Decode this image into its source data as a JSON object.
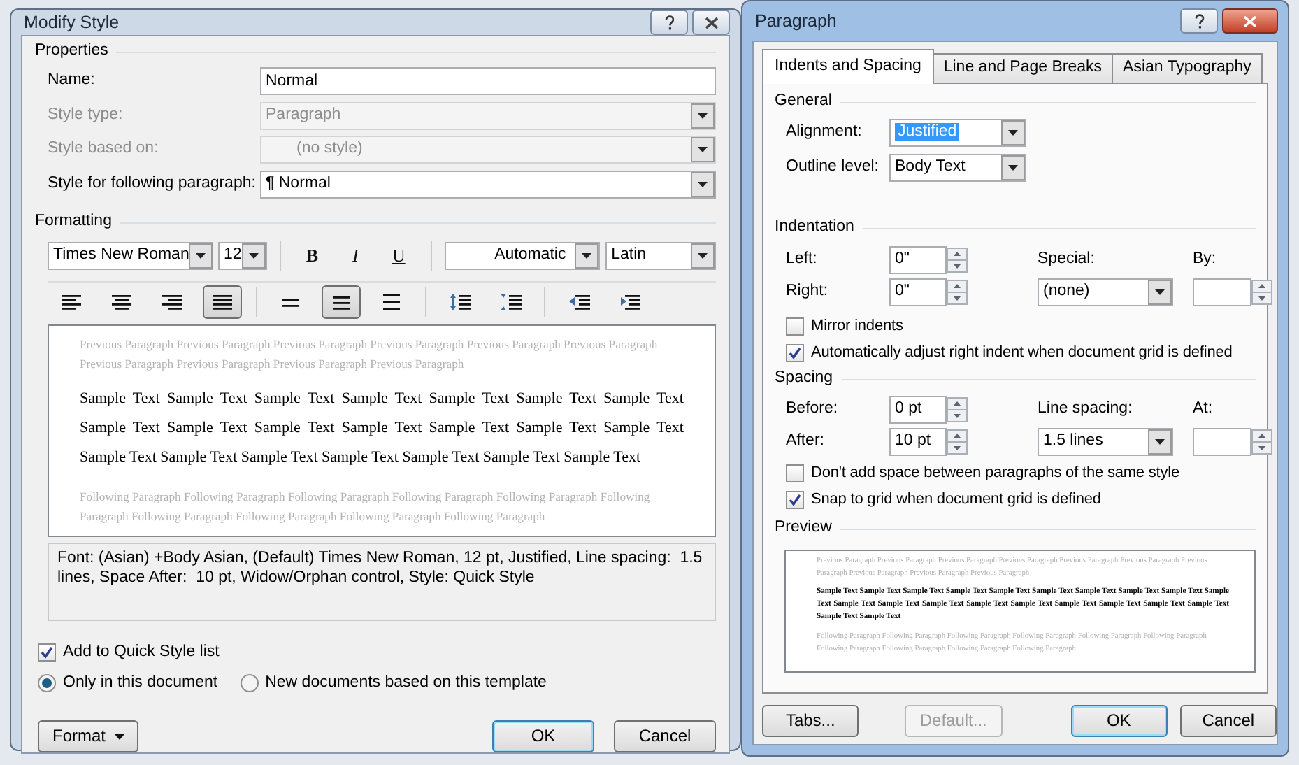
{
  "modify_style": {
    "title": "Modify Style",
    "properties": {
      "heading": "Properties",
      "fields": [
        {
          "kind": "text",
          "label": "Name:",
          "value": "Normal",
          "disabled": false
        },
        {
          "kind": "combo",
          "label": "Style type:",
          "value": "Paragraph",
          "disabled": true
        },
        {
          "kind": "combo",
          "label": "Style based on:",
          "value": "(no style)",
          "disabled": true
        },
        {
          "kind": "combo",
          "label": "Style for following paragraph:",
          "value": "¶ Normal",
          "disabled": false
        }
      ]
    },
    "formatting": {
      "heading": "Formatting",
      "font": "Times New Roman",
      "size": "12",
      "styles": [
        {
          "kind": "bold",
          "label": "B",
          "selected": false
        },
        {
          "kind": "italic",
          "label": "I",
          "selected": false
        },
        {
          "kind": "underline",
          "label": "U",
          "selected": false
        }
      ],
      "font_color": "Automatic",
      "script": "Latin",
      "paragraph_tools": [
        [
          {
            "kind": "align-left",
            "selected": false
          },
          {
            "kind": "align-center",
            "selected": false
          },
          {
            "kind": "align-right",
            "selected": false
          },
          {
            "kind": "justify",
            "selected": true
          }
        ],
        [
          {
            "kind": "single-spacing",
            "selected": false
          },
          {
            "kind": "one-half-spacing",
            "selected": true
          },
          {
            "kind": "double-spacing",
            "selected": false
          }
        ],
        [
          {
            "kind": "increase-paragraph-spacing",
            "selected": false
          },
          {
            "kind": "decrease-paragraph-spacing",
            "selected": false
          }
        ],
        [
          {
            "kind": "decrease-indent",
            "selected": false
          },
          {
            "kind": "increase-indent",
            "selected": false
          }
        ]
      ]
    },
    "preview": {
      "previous": "Previous Paragraph Previous Paragraph Previous Paragraph Previous Paragraph Previous Paragraph Previous Paragraph Previous Paragraph Previous Paragraph Previous Paragraph Previous Paragraph",
      "sample": "Sample Text Sample Text Sample Text Sample Text Sample Text Sample Text Sample Text Sample Text Sample Text Sample Text Sample Text Sample Text Sample Text Sample Text Sample Text Sample Text Sample Text Sample Text Sample Text Sample Text Sample Text",
      "following": "Following Paragraph Following Paragraph Following Paragraph Following Paragraph Following Paragraph Following Paragraph Following Paragraph Following Paragraph Following Paragraph Following Paragraph"
    },
    "description": "Font: (Asian) +Body Asian, (Default) Times New Roman, 12 pt, Justified, Line spacing:  1.5 lines, Space After:  10 pt, Widow/Orphan control, Style: Quick Style",
    "add_to_quick_style": {
      "label": "Add to Quick Style list",
      "checked": true
    },
    "scope": [
      {
        "label": "Only in this document",
        "selected": true
      },
      {
        "label": "New documents based on this template",
        "selected": false
      }
    ],
    "buttons": [
      {
        "kind": "menu",
        "label": "Format",
        "disabled": false
      },
      {
        "kind": "default",
        "label": "OK",
        "disabled": false
      },
      {
        "kind": "plain",
        "label": "Cancel",
        "disabled": false
      }
    ]
  },
  "paragraph": {
    "title": "Paragraph",
    "tabs": [
      {
        "label": "Indents and Spacing",
        "selected": true
      },
      {
        "label": "Line and Page Breaks",
        "selected": false
      },
      {
        "label": "Asian Typography",
        "selected": false
      }
    ],
    "general": {
      "heading": "General",
      "fields": [
        {
          "label": "Alignment:",
          "value": "Justified",
          "highlighted": true
        },
        {
          "label": "Outline level:",
          "value": "Body Text",
          "highlighted": false
        }
      ]
    },
    "indentation": {
      "heading": "Indentation",
      "left": {
        "label": "Left:",
        "value": "0\""
      },
      "right": {
        "label": "Right:",
        "value": "0\""
      },
      "special": {
        "label": "Special:",
        "value": "(none)"
      },
      "by": {
        "label": "By:"
      },
      "options": [
        {
          "label": "Mirror indents",
          "checked": false
        },
        {
          "label": "Automatically adjust right indent when document grid is defined",
          "checked": true
        }
      ]
    },
    "spacing": {
      "heading": "Spacing",
      "before": {
        "label": "Before:",
        "value": "0 pt"
      },
      "after": {
        "label": "After:",
        "value": "10 pt"
      },
      "line_spacing": {
        "label": "Line spacing:",
        "value": "1.5 lines"
      },
      "at": {
        "label": "At:"
      },
      "options": [
        {
          "label": "Don't add space between paragraphs of the same style",
          "checked": false
        },
        {
          "label": "Snap to grid when document grid is defined",
          "checked": true
        }
      ]
    },
    "preview": {
      "heading": "Preview",
      "previous": "Previous Paragraph Previous Paragraph Previous Paragraph Previous Paragraph Previous Paragraph Previous Paragraph Previous Paragraph Previous Paragraph Previous Paragraph Previous Paragraph",
      "sample": "Sample Text Sample Text Sample Text Sample Text Sample Text Sample Text Sample Text Sample Text Sample Text Sample Text Sample Text Sample Text Sample Text Sample Text Sample Text Sample Text Sample Text Sample Text Sample Text Sample Text Sample Text",
      "following": "Following Paragraph Following Paragraph Following Paragraph Following Paragraph Following Paragraph Following Paragraph Following Paragraph Following Paragraph Following Paragraph Following Paragraph"
    },
    "buttons": [
      {
        "kind": "plain",
        "label": "Tabs...",
        "disabled": false
      },
      {
        "kind": "plain",
        "label": "Default...",
        "disabled": true
      },
      {
        "kind": "default",
        "label": "OK",
        "disabled": false
      },
      {
        "kind": "plain",
        "label": "Cancel",
        "disabled": false
      }
    ]
  }
}
